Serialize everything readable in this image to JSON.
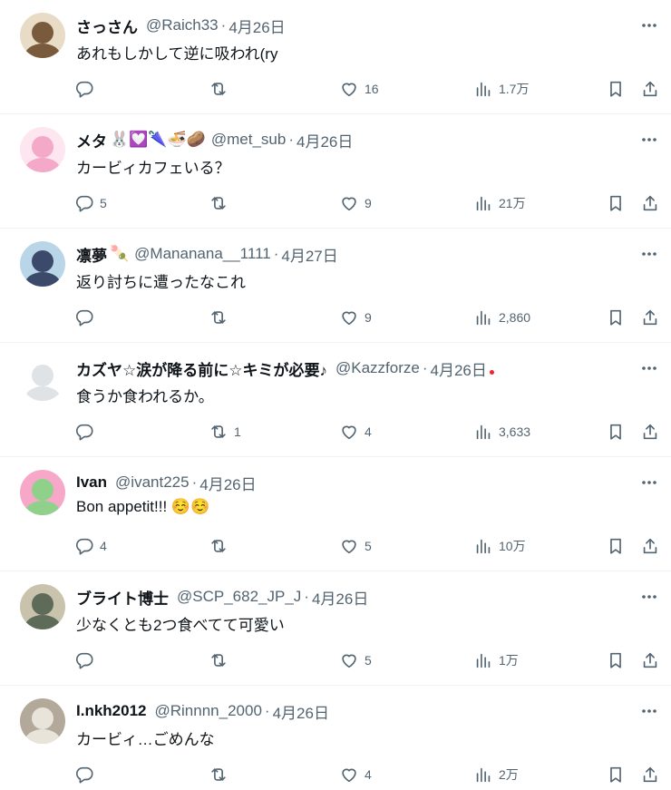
{
  "colors": {
    "text": "#0f1419",
    "secondary": "#536471",
    "divider": "#eff3f4",
    "badge": "#f4212e"
  },
  "more_icon": "more-horizontal-icon",
  "tweets": [
    {
      "name": "さっさん",
      "emojis": "",
      "handle": "@Raich33",
      "sep": "·",
      "date": "4月26日",
      "text": "あれもしかして逆に吸われ(ry",
      "reply_count": "",
      "retweet_count": "",
      "like_count": "16",
      "view_count": "1.7万",
      "avatar_colors": [
        "#7a5a3c",
        "#e8dcc6"
      ]
    },
    {
      "name": "メタ",
      "emojis": "🐰💟🌂🍜🥔",
      "handle": "@met_sub",
      "sep": "·",
      "date": "4月26日",
      "text": "カービィカフェいる？",
      "reply_count": "5",
      "retweet_count": "",
      "like_count": "9",
      "view_count": "21万",
      "avatar_colors": [
        "#f4a9c8",
        "#fde6ef"
      ]
    },
    {
      "name": "凛夢",
      "emojis": "🍡",
      "handle": "@Mananana__1111",
      "sep": "·",
      "date": "4月27日",
      "text": "返り討ちに遭ったなこれ",
      "reply_count": "",
      "retweet_count": "",
      "like_count": "9",
      "view_count": "2,860",
      "avatar_colors": [
        "#3b4a6b",
        "#b9d6e8"
      ]
    },
    {
      "name": "カズヤ☆涙が降る前に☆キミが必要♪",
      "emojis": "",
      "handle": "@Kazzforze",
      "sep": "·",
      "date": "4月26日",
      "text": "食うか食われるか。",
      "reply_count": "",
      "retweet_count": "1",
      "like_count": "4",
      "view_count": "3,633",
      "avatar_colors": [
        "#dfe3e6",
        "#ffffff"
      ],
      "badge": true
    },
    {
      "name": "Ivan",
      "emojis": "",
      "handle": "@ivant225",
      "sep": "·",
      "date": "4月26日",
      "text": "Bon appetit!!! ☺️☺️",
      "reply_count": "4",
      "retweet_count": "",
      "like_count": "5",
      "view_count": "10万",
      "avatar_colors": [
        "#8fd18b",
        "#f7a8c8"
      ]
    },
    {
      "name": "ブライト博士",
      "emojis": "",
      "handle": "@SCP_682_JP_J",
      "sep": "·",
      "date": "4月26日",
      "text": "少なくとも2つ食べてて可愛い",
      "reply_count": "",
      "retweet_count": "",
      "like_count": "5",
      "view_count": "1万",
      "avatar_colors": [
        "#5d6b58",
        "#c9c2ad"
      ]
    },
    {
      "name": "I.nkh2012",
      "emojis": "",
      "handle": "@Rinnnn_2000",
      "sep": "·",
      "date": "4月26日",
      "text": "カービィ…ごめんな",
      "reply_count": "",
      "retweet_count": "",
      "like_count": "4",
      "view_count": "2万",
      "avatar_colors": [
        "#e9e4da",
        "#b3a99a"
      ]
    }
  ]
}
